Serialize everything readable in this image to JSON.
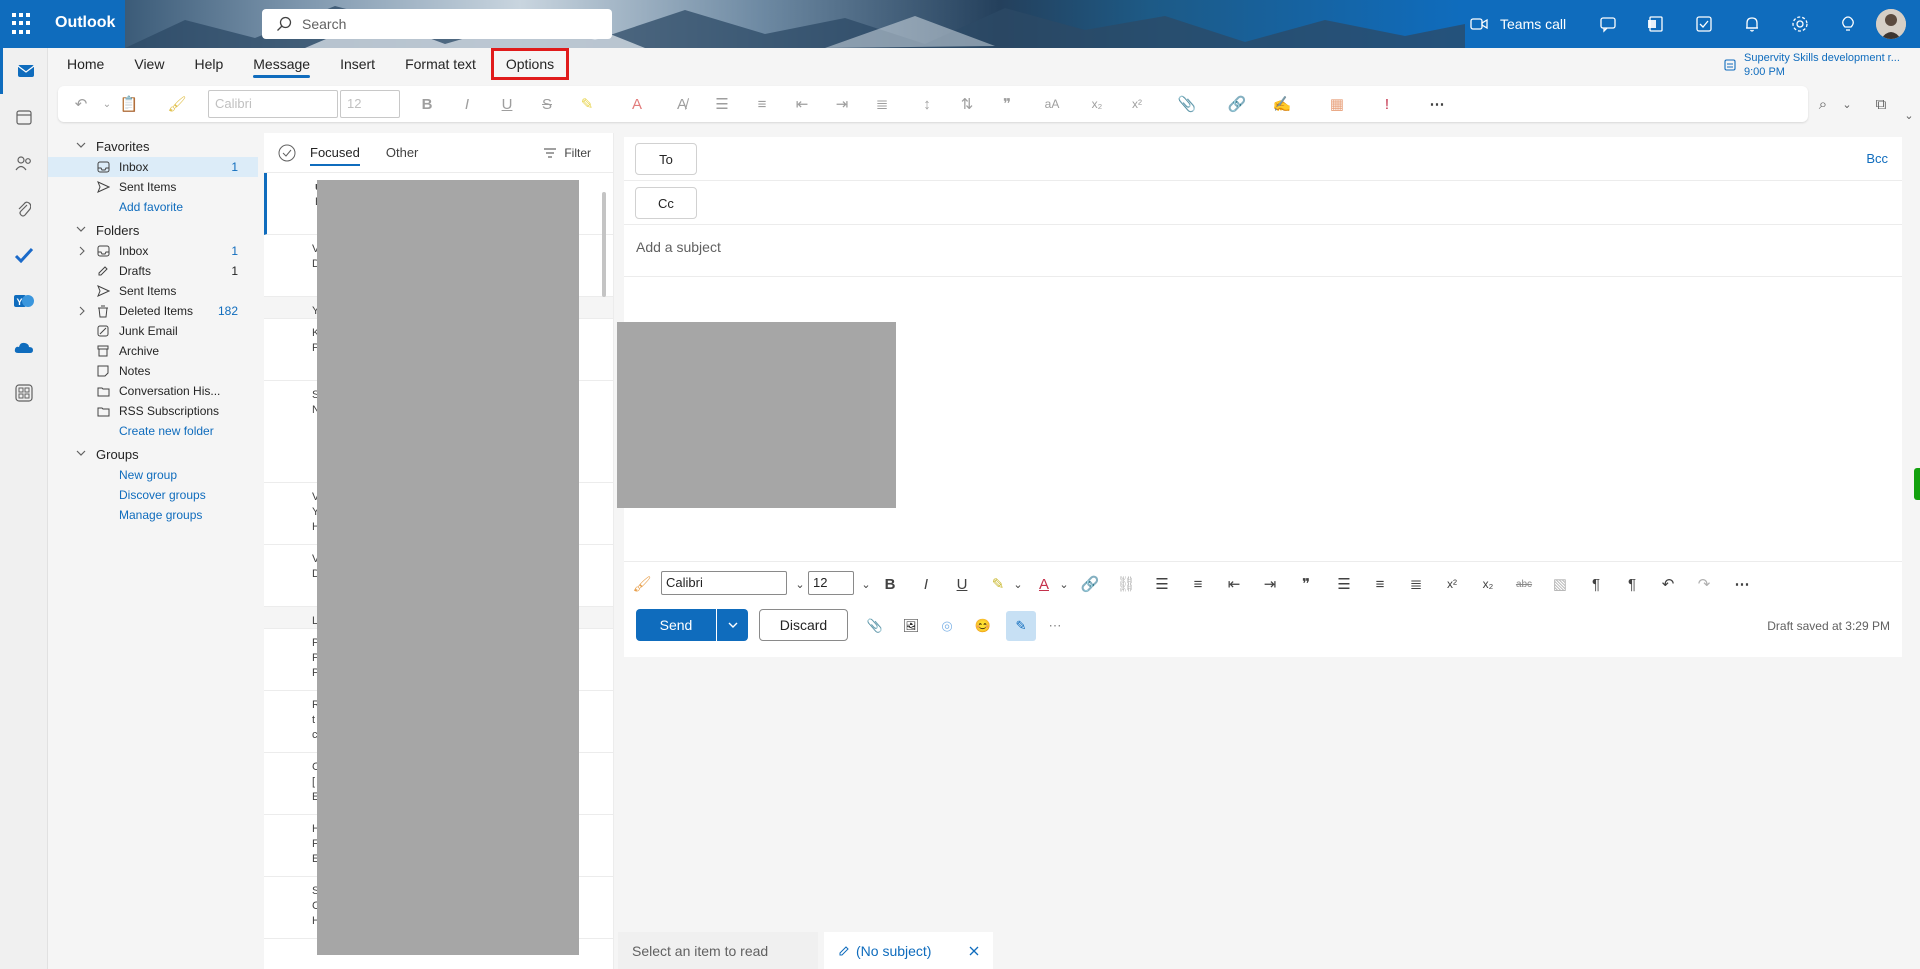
{
  "app": {
    "name": "Outlook"
  },
  "header": {
    "search_placeholder": "Search",
    "teams_call": "Teams call"
  },
  "ribbon": {
    "tabs": [
      {
        "label": "Home"
      },
      {
        "label": "View"
      },
      {
        "label": "Help"
      },
      {
        "label": "Message",
        "active": true
      },
      {
        "label": "Insert"
      },
      {
        "label": "Format text"
      },
      {
        "label": "Options",
        "highlighted": true
      }
    ],
    "reminder": {
      "title": "Supervity Skills development r...",
      "time": "9:00 PM"
    },
    "font_name": "Calibri",
    "font_size": "12"
  },
  "folders": {
    "favorites_label": "Favorites",
    "favorites": [
      {
        "label": "Inbox",
        "count": "1",
        "icon": "inbox-icon"
      },
      {
        "label": "Sent Items",
        "count": "",
        "icon": "send-icon"
      }
    ],
    "add_favorite": "Add favorite",
    "folders_label": "Folders",
    "items": [
      {
        "label": "Inbox",
        "count": "1",
        "icon": "inbox-icon"
      },
      {
        "label": "Drafts",
        "count": "1",
        "icon": "draft-icon"
      },
      {
        "label": "Sent Items",
        "count": "",
        "icon": "send-icon"
      },
      {
        "label": "Deleted Items",
        "count": "182",
        "icon": "trash-icon"
      },
      {
        "label": "Junk Email",
        "count": "",
        "icon": "junk-icon"
      },
      {
        "label": "Archive",
        "count": "",
        "icon": "archive-icon"
      },
      {
        "label": "Notes",
        "count": "",
        "icon": "note-icon"
      },
      {
        "label": "Conversation His...",
        "count": "",
        "icon": "folder-icon"
      },
      {
        "label": "RSS Subscriptions",
        "count": "",
        "icon": "folder-icon"
      }
    ],
    "create_folder": "Create new folder",
    "groups_label": "Groups",
    "groups": [
      "New group",
      "Discover groups",
      "Manage groups"
    ]
  },
  "message_list": {
    "tab_focused": "Focused",
    "tab_other": "Other",
    "filter": "Filter",
    "row_initials": [
      "u",
      "E",
      "V",
      "D",
      "Y",
      "K",
      "P",
      "S",
      "N",
      "V",
      "Y",
      "H",
      "V",
      "D",
      "L",
      "P",
      "P",
      "P",
      "R",
      "t",
      "c",
      "C",
      "[",
      "E",
      "H",
      "F",
      "E",
      "S",
      "C",
      "H"
    ]
  },
  "compose": {
    "to_label": "To",
    "cc_label": "Cc",
    "bcc_label": "Bcc",
    "subject_placeholder": "Add a subject",
    "font_name": "Calibri",
    "font_size": "12",
    "send_label": "Send",
    "discard_label": "Discard",
    "draft_status": "Draft saved at 3:29 PM"
  },
  "bottom_tabs": {
    "select_item": "Select an item to read",
    "draft_tab": "(No subject)"
  },
  "colors": {
    "accent": "#0f6cbd",
    "highlight": "#e01b1b"
  }
}
